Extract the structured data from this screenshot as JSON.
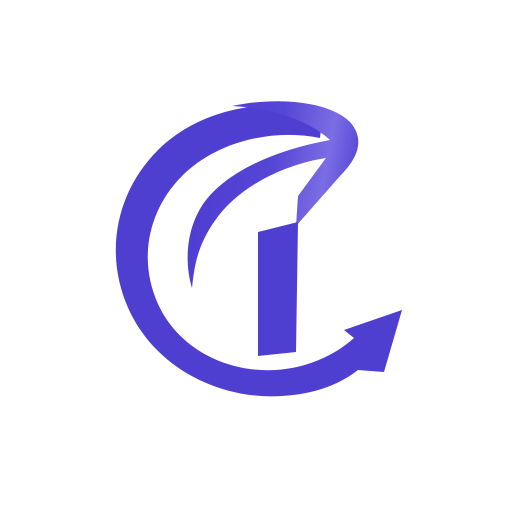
{
  "logo": {
    "icon": "ct-monogram-logo-with-arrow",
    "colors": {
      "primary": "#4F3FD1",
      "highlight": "#7D6FE6",
      "background": "#FFFFFF"
    }
  }
}
